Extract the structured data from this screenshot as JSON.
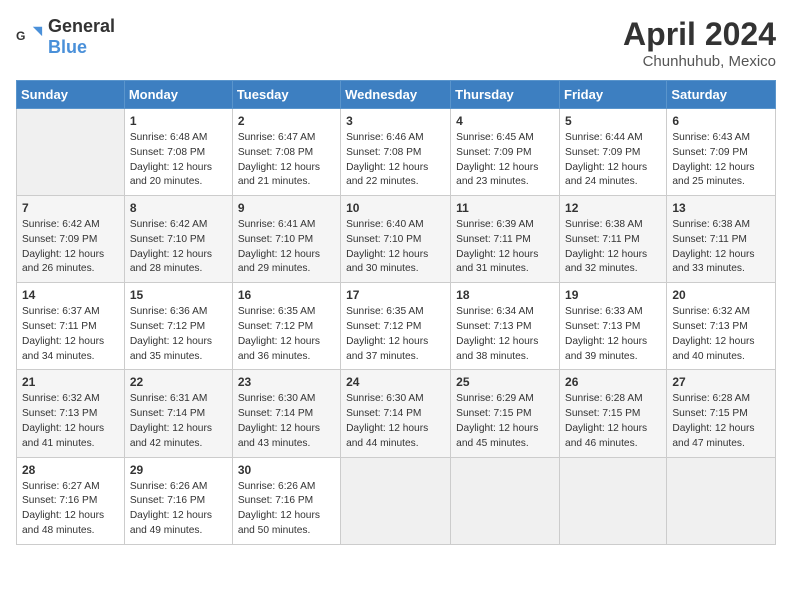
{
  "logo": {
    "general": "General",
    "blue": "Blue"
  },
  "header": {
    "month_year": "April 2024",
    "location": "Chunhuhub, Mexico"
  },
  "days_of_week": [
    "Sunday",
    "Monday",
    "Tuesday",
    "Wednesday",
    "Thursday",
    "Friday",
    "Saturday"
  ],
  "weeks": [
    [
      {
        "day": "",
        "info": ""
      },
      {
        "day": "1",
        "info": "Sunrise: 6:48 AM\nSunset: 7:08 PM\nDaylight: 12 hours and 20 minutes."
      },
      {
        "day": "2",
        "info": "Sunrise: 6:47 AM\nSunset: 7:08 PM\nDaylight: 12 hours and 21 minutes."
      },
      {
        "day": "3",
        "info": "Sunrise: 6:46 AM\nSunset: 7:08 PM\nDaylight: 12 hours and 22 minutes."
      },
      {
        "day": "4",
        "info": "Sunrise: 6:45 AM\nSunset: 7:09 PM\nDaylight: 12 hours and 23 minutes."
      },
      {
        "day": "5",
        "info": "Sunrise: 6:44 AM\nSunset: 7:09 PM\nDaylight: 12 hours and 24 minutes."
      },
      {
        "day": "6",
        "info": "Sunrise: 6:43 AM\nSunset: 7:09 PM\nDaylight: 12 hours and 25 minutes."
      }
    ],
    [
      {
        "day": "7",
        "info": "Sunrise: 6:42 AM\nSunset: 7:09 PM\nDaylight: 12 hours and 26 minutes."
      },
      {
        "day": "8",
        "info": "Sunrise: 6:42 AM\nSunset: 7:10 PM\nDaylight: 12 hours and 28 minutes."
      },
      {
        "day": "9",
        "info": "Sunrise: 6:41 AM\nSunset: 7:10 PM\nDaylight: 12 hours and 29 minutes."
      },
      {
        "day": "10",
        "info": "Sunrise: 6:40 AM\nSunset: 7:10 PM\nDaylight: 12 hours and 30 minutes."
      },
      {
        "day": "11",
        "info": "Sunrise: 6:39 AM\nSunset: 7:11 PM\nDaylight: 12 hours and 31 minutes."
      },
      {
        "day": "12",
        "info": "Sunrise: 6:38 AM\nSunset: 7:11 PM\nDaylight: 12 hours and 32 minutes."
      },
      {
        "day": "13",
        "info": "Sunrise: 6:38 AM\nSunset: 7:11 PM\nDaylight: 12 hours and 33 minutes."
      }
    ],
    [
      {
        "day": "14",
        "info": "Sunrise: 6:37 AM\nSunset: 7:11 PM\nDaylight: 12 hours and 34 minutes."
      },
      {
        "day": "15",
        "info": "Sunrise: 6:36 AM\nSunset: 7:12 PM\nDaylight: 12 hours and 35 minutes."
      },
      {
        "day": "16",
        "info": "Sunrise: 6:35 AM\nSunset: 7:12 PM\nDaylight: 12 hours and 36 minutes."
      },
      {
        "day": "17",
        "info": "Sunrise: 6:35 AM\nSunset: 7:12 PM\nDaylight: 12 hours and 37 minutes."
      },
      {
        "day": "18",
        "info": "Sunrise: 6:34 AM\nSunset: 7:13 PM\nDaylight: 12 hours and 38 minutes."
      },
      {
        "day": "19",
        "info": "Sunrise: 6:33 AM\nSunset: 7:13 PM\nDaylight: 12 hours and 39 minutes."
      },
      {
        "day": "20",
        "info": "Sunrise: 6:32 AM\nSunset: 7:13 PM\nDaylight: 12 hours and 40 minutes."
      }
    ],
    [
      {
        "day": "21",
        "info": "Sunrise: 6:32 AM\nSunset: 7:13 PM\nDaylight: 12 hours and 41 minutes."
      },
      {
        "day": "22",
        "info": "Sunrise: 6:31 AM\nSunset: 7:14 PM\nDaylight: 12 hours and 42 minutes."
      },
      {
        "day": "23",
        "info": "Sunrise: 6:30 AM\nSunset: 7:14 PM\nDaylight: 12 hours and 43 minutes."
      },
      {
        "day": "24",
        "info": "Sunrise: 6:30 AM\nSunset: 7:14 PM\nDaylight: 12 hours and 44 minutes."
      },
      {
        "day": "25",
        "info": "Sunrise: 6:29 AM\nSunset: 7:15 PM\nDaylight: 12 hours and 45 minutes."
      },
      {
        "day": "26",
        "info": "Sunrise: 6:28 AM\nSunset: 7:15 PM\nDaylight: 12 hours and 46 minutes."
      },
      {
        "day": "27",
        "info": "Sunrise: 6:28 AM\nSunset: 7:15 PM\nDaylight: 12 hours and 47 minutes."
      }
    ],
    [
      {
        "day": "28",
        "info": "Sunrise: 6:27 AM\nSunset: 7:16 PM\nDaylight: 12 hours and 48 minutes."
      },
      {
        "day": "29",
        "info": "Sunrise: 6:26 AM\nSunset: 7:16 PM\nDaylight: 12 hours and 49 minutes."
      },
      {
        "day": "30",
        "info": "Sunrise: 6:26 AM\nSunset: 7:16 PM\nDaylight: 12 hours and 50 minutes."
      },
      {
        "day": "",
        "info": ""
      },
      {
        "day": "",
        "info": ""
      },
      {
        "day": "",
        "info": ""
      },
      {
        "day": "",
        "info": ""
      }
    ]
  ]
}
